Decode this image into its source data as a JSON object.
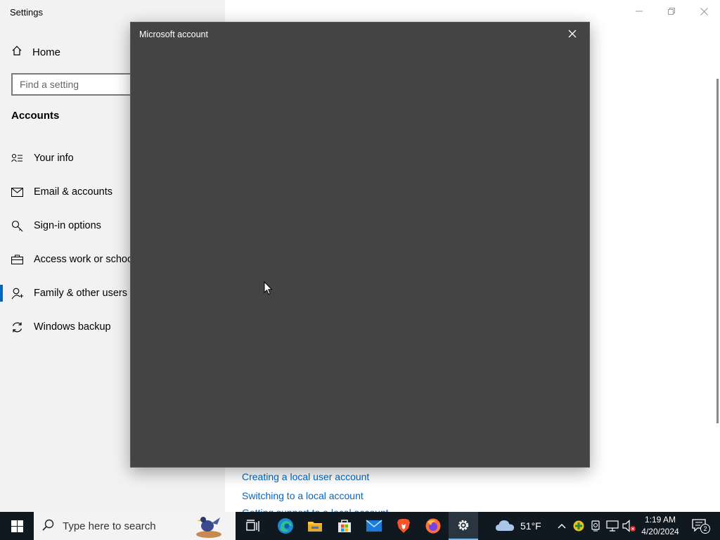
{
  "settings_window": {
    "app_title": "Settings",
    "home_label": "Home",
    "search_placeholder": "Find a setting",
    "section_title": "Accounts",
    "nav_items": [
      {
        "label": "Your info",
        "icon": "person-card-icon"
      },
      {
        "label": "Email & accounts",
        "icon": "mail-icon"
      },
      {
        "label": "Sign-in options",
        "icon": "key-icon"
      },
      {
        "label": "Access work or school",
        "icon": "briefcase-icon"
      },
      {
        "label": "Family & other users",
        "icon": "person-add-icon",
        "selected": true
      },
      {
        "label": "Windows backup",
        "icon": "sync-icon"
      }
    ],
    "links": [
      "Creating a local user account",
      "Switching to a local account",
      "Getting support to a local account"
    ],
    "window_controls": [
      "minimize",
      "restore",
      "close"
    ]
  },
  "dialog": {
    "title": "Microsoft account",
    "close_icon": "close-icon"
  },
  "taskbar": {
    "search_placeholder": "Type here to search",
    "pinned": [
      "task-view",
      "edge",
      "file-explorer",
      "microsoft-store",
      "mail",
      "brave",
      "firefox",
      "settings"
    ],
    "active_app": "settings",
    "weather": {
      "temp": "51°F",
      "icon": "cloud-icon"
    },
    "clock": {
      "time": "1:19 AM",
      "date": "4/20/2024"
    },
    "notifications_count": "2"
  },
  "colors": {
    "accent": "#0067c0",
    "sidebar_bg": "#f2f2f2",
    "dialog_bg": "#444444",
    "taskbar_bg": "#101820"
  }
}
